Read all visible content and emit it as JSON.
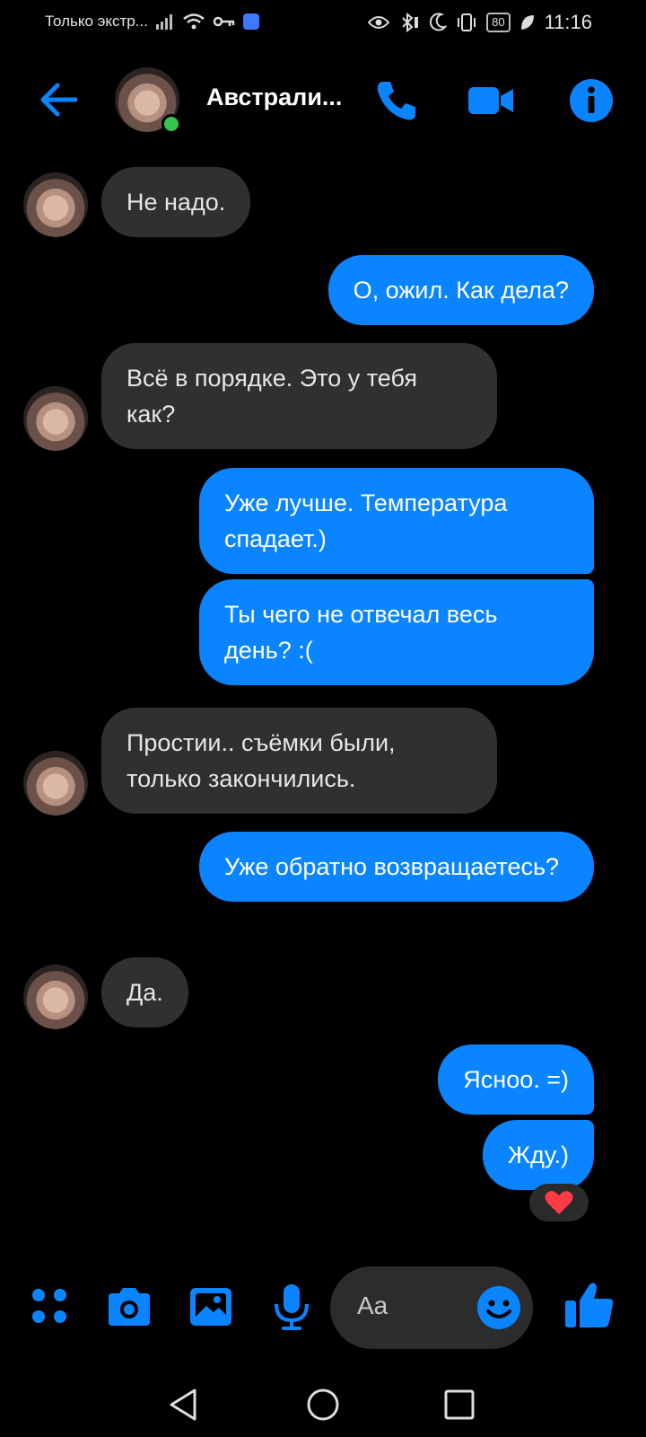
{
  "status_bar": {
    "carrier_text": "Только экстр...",
    "battery": "80",
    "time": "11:16"
  },
  "header": {
    "contact_name": "Австрали..."
  },
  "messages": [
    {
      "side": "in",
      "text": "Не надо."
    },
    {
      "side": "out",
      "text": "О, ожил. Как дела?"
    },
    {
      "side": "in",
      "text": "Всё в порядке. Это у тебя как?"
    },
    {
      "side": "out",
      "text": "Уже лучше. Температура спадает.)"
    },
    {
      "side": "out",
      "text": "Ты чего не отвечал весь день? :("
    },
    {
      "side": "in",
      "text": "Простии.. съёмки были, только закончились."
    },
    {
      "side": "out",
      "text": "Уже обратно возвращаетесь?"
    },
    {
      "side": "in",
      "text": "Да."
    },
    {
      "side": "out",
      "text": "Ясноо. =)"
    },
    {
      "side": "out",
      "text": "Жду.)"
    }
  ],
  "reaction": "❤️",
  "composer": {
    "placeholder": "Aa"
  },
  "colors": {
    "accent": "#0a84ff",
    "incoming_bubble": "#303030",
    "background": "#000000",
    "online": "#31c553"
  }
}
